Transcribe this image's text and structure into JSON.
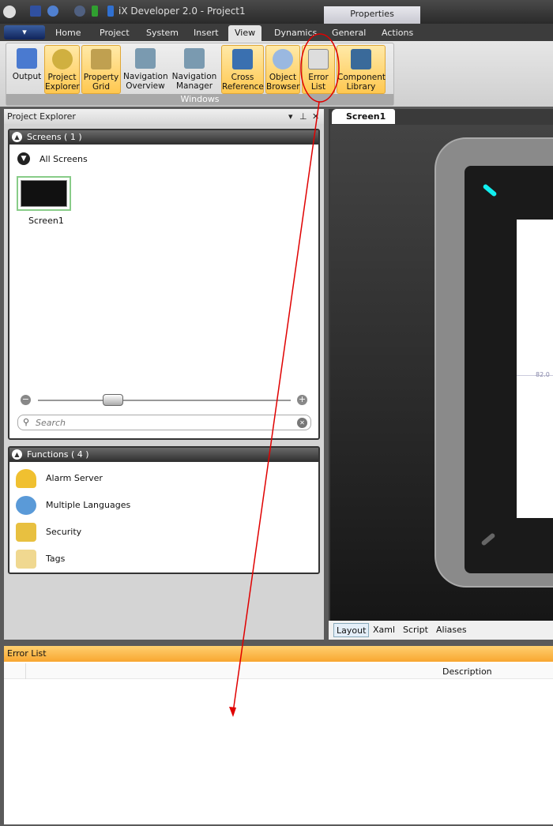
{
  "titlebar": {
    "title": "iX Developer 2.0 - Project1",
    "context_tab": "Properties"
  },
  "tabs": [
    "Home",
    "Project",
    "System",
    "Insert",
    "View",
    "Dynamics",
    "General",
    "Actions"
  ],
  "active_tab": "View",
  "ribbon": {
    "group_label": "Windows",
    "buttons": [
      {
        "line1": "Output",
        "line2": "",
        "active": false
      },
      {
        "line1": "Project",
        "line2": "Explorer",
        "active": true
      },
      {
        "line1": "Property",
        "line2": "Grid",
        "active": true
      },
      {
        "line1": "Navigation",
        "line2": "Overview",
        "active": false
      },
      {
        "line1": "Navigation",
        "line2": "Manager",
        "active": false
      },
      {
        "line1": "Cross",
        "line2": "Reference",
        "active": true
      },
      {
        "line1": "Object",
        "line2": "Browser",
        "active": true
      },
      {
        "line1": "Error",
        "line2": "List",
        "active": true
      },
      {
        "line1": "Component",
        "line2": "Library",
        "active": true
      }
    ]
  },
  "project_explorer": {
    "title": "Project Explorer",
    "screens": {
      "header": "Screens ( 1 )",
      "filter": "All Screens",
      "items": [
        "Screen1"
      ],
      "search_placeholder": "Search"
    },
    "functions": {
      "header": "Functions ( 4 )",
      "items": [
        "Alarm Server",
        "Multiple Languages",
        "Security",
        "Tags"
      ]
    }
  },
  "editor": {
    "tab": "Screen1",
    "value_label": "82.0",
    "bottom_tabs": [
      "Layout",
      "Xaml",
      "Script",
      "Aliases"
    ]
  },
  "error_list": {
    "title": "Error List",
    "columns": [
      "",
      "Description"
    ]
  },
  "colors": {
    "accent": "#ffc850",
    "annotation": "#e00000"
  }
}
